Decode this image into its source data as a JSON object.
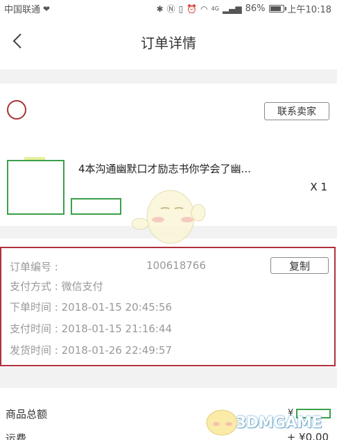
{
  "status_bar": {
    "carrier": "中国联通",
    "network": "4G",
    "battery_percent": "86%",
    "battery_level": 0.86,
    "time": "上午10:18"
  },
  "header": {
    "title": "订单详情"
  },
  "seller": {
    "contact_label": "联系卖家"
  },
  "product": {
    "title": "4本沟通幽默口才励志书你学会了幽...",
    "quantity": "X 1"
  },
  "order": {
    "number_label": "订单编号 :",
    "number_value": "100618766",
    "copy_label": "复制",
    "rows": [
      {
        "label": "支付方式 :",
        "value": "微信支付"
      },
      {
        "label": "下单时间 :",
        "value": "2018-01-15 20:45:56"
      },
      {
        "label": "支付时间 :",
        "value": "2018-01-15 21:16:44"
      },
      {
        "label": "发货时间 :",
        "value": "2018-01-26 22:49:57"
      }
    ]
  },
  "totals": {
    "goods_total_label": "商品总额",
    "goods_total_prefix": "¥",
    "shipping_label": "运费",
    "shipping_value": "+ ¥0.00"
  },
  "watermark": {
    "text": "3DMGAME"
  },
  "colors": {
    "highlight": "#b0303a",
    "redaction": "#3aa04a",
    "section_gap": "#f2f2f2"
  }
}
